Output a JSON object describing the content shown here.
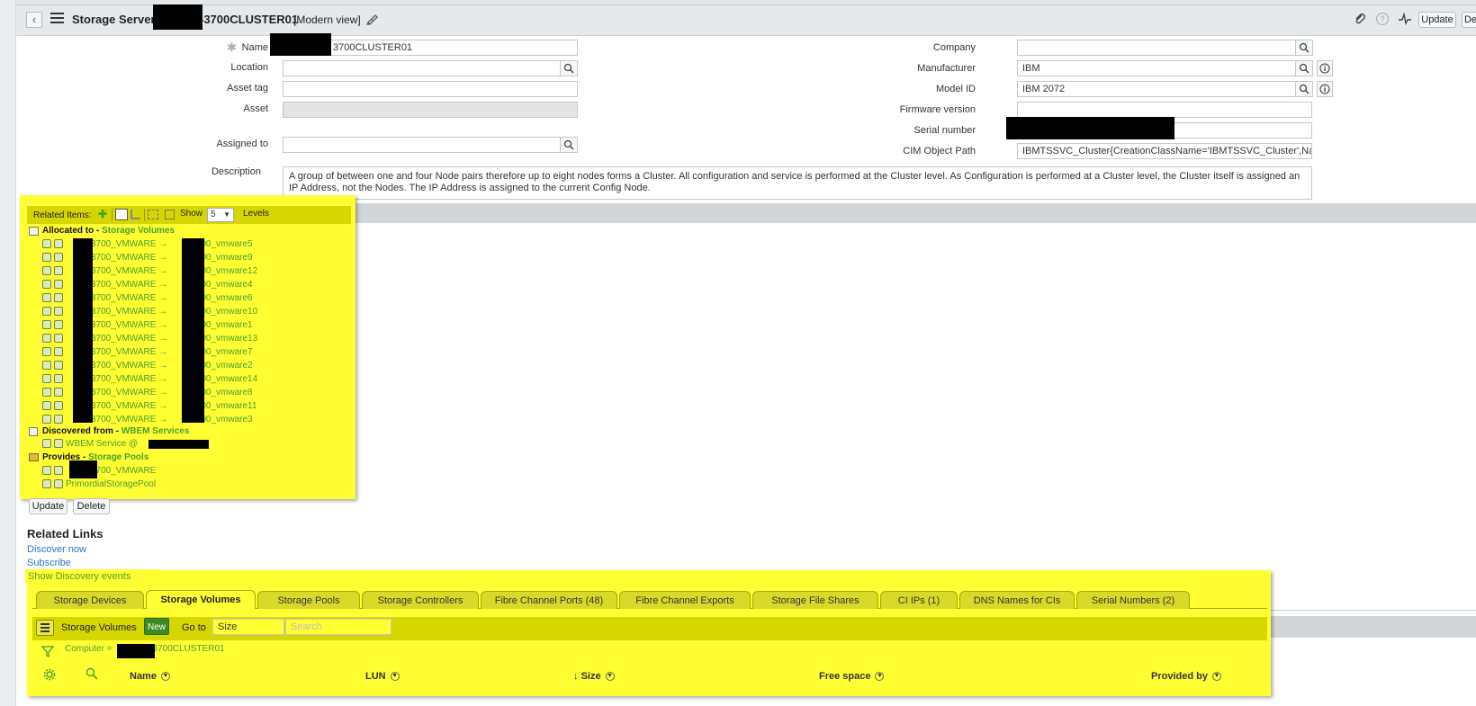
{
  "header": {
    "title_prefix": "Storage Server",
    "title_suffix": "-3700CLUSTER01",
    "view_mode": "[Modern view]",
    "update_label": "Update",
    "delete_label_partial": "De",
    "icons": [
      "back-icon",
      "hamburger-icon",
      "attachment-icon",
      "help-icon",
      "activity-icon"
    ]
  },
  "form": {
    "name_label": "Name",
    "name_value": "3700CLUSTER01",
    "location_label": "Location",
    "location_value": "",
    "asset_tag_label": "Asset tag",
    "asset_tag_value": "",
    "asset_label": "Asset",
    "asset_value": "",
    "assigned_to_label": "Assigned to",
    "assigned_to_value": "",
    "description_label": "Description",
    "description_value": "A group of between one and four Node pairs therefore up to eight nodes forms a Cluster. All configuration and service is performed at the Cluster level. As Configuration is performed at a Cluster level, the Cluster itself is assigned an IP Address, not the Nodes. The IP Address is assigned to the current Config Node.",
    "company_label": "Company",
    "company_value": "",
    "manufacturer_label": "Manufacturer",
    "manufacturer_value": "IBM",
    "model_id_label": "Model ID",
    "model_id_value": "IBM 2072",
    "firmware_label": "Firmware version",
    "firmware_value": "",
    "serial_label": "Serial number",
    "serial_value": "",
    "cim_label": "CIM Object Path",
    "cim_value": "IBMTSSVC_Cluster{CreationClassName='IBMTSSVC_Cluster',Name"
  },
  "related_items": {
    "label": "Related Items:",
    "show_label": "Show",
    "levels_value": "5",
    "levels_label": "Levels",
    "allocated_prefix": "Allocated to - ",
    "allocated_link": "Storage Volumes",
    "volumes": [
      {
        "left": "3700_VMWARE →",
        "right": "3700_vmware5"
      },
      {
        "left": "3700_VMWARE →",
        "right": "3700_vmware9"
      },
      {
        "left": "3700_VMWARE →",
        "right": "3700_vmware12"
      },
      {
        "left": "3700_VMWARE →",
        "right": "3700_vmware4"
      },
      {
        "left": "3700_VMWARE →",
        "right": "3700_vmware6"
      },
      {
        "left": "3700_VMWARE →",
        "right": "3700_vmware10"
      },
      {
        "left": "3700_VMWARE →",
        "right": "3700_vmware1"
      },
      {
        "left": "3700_VMWARE →",
        "right": "3700_vmware13"
      },
      {
        "left": "3700_VMWARE →",
        "right": "3700_vmware7"
      },
      {
        "left": "3700_VMWARE →",
        "right": "3700_vmware2"
      },
      {
        "left": "3700_VMWARE →",
        "right": "3700_vmware14"
      },
      {
        "left": "3700_VMWARE →",
        "right": "3700_vmware8"
      },
      {
        "left": "3700_VMWARE →",
        "right": "3700_vmware11"
      },
      {
        "left": "3700_VMWARE →",
        "right": "3700_vmware3"
      }
    ],
    "discovered_prefix": "Discovered from - ",
    "discovered_link": "WBEM Services",
    "wbem_item": "WBEM Service @",
    "provides_prefix": "Provides - ",
    "provides_link": "Storage Pools",
    "pools": [
      "3700_VMWARE",
      "PrimordialStoragePool"
    ]
  },
  "form_buttons": {
    "update": "Update",
    "delete": "Delete"
  },
  "related_links": {
    "title": "Related Links",
    "items": [
      "Discover now",
      "Subscribe",
      "Show Discovery events"
    ]
  },
  "tabs": [
    "Storage Devices",
    "Storage Volumes",
    "Storage Pools",
    "Storage Controllers",
    "Fibre Channel Ports (48)",
    "Fibre Channel Exports",
    "Storage File Shares",
    "CI IPs (1)",
    "DNS Names for CIs",
    "Serial Numbers (2)"
  ],
  "list": {
    "title": "Storage Volumes",
    "new_label": "New",
    "goto_label": "Go to",
    "goto_field": "Size",
    "search_placeholder": "Search",
    "filter_prefix": "Computer =",
    "filter_suffix": "3700CLUSTER01",
    "columns": [
      "Name",
      "LUN",
      "Size",
      "Free space",
      "Provided by"
    ],
    "sort_arrow": "↓"
  },
  "colors": {
    "highlight": "#ffff33",
    "highlight_dark": "#d6d600",
    "link": "#2777c2",
    "green": "#4aa02c"
  }
}
